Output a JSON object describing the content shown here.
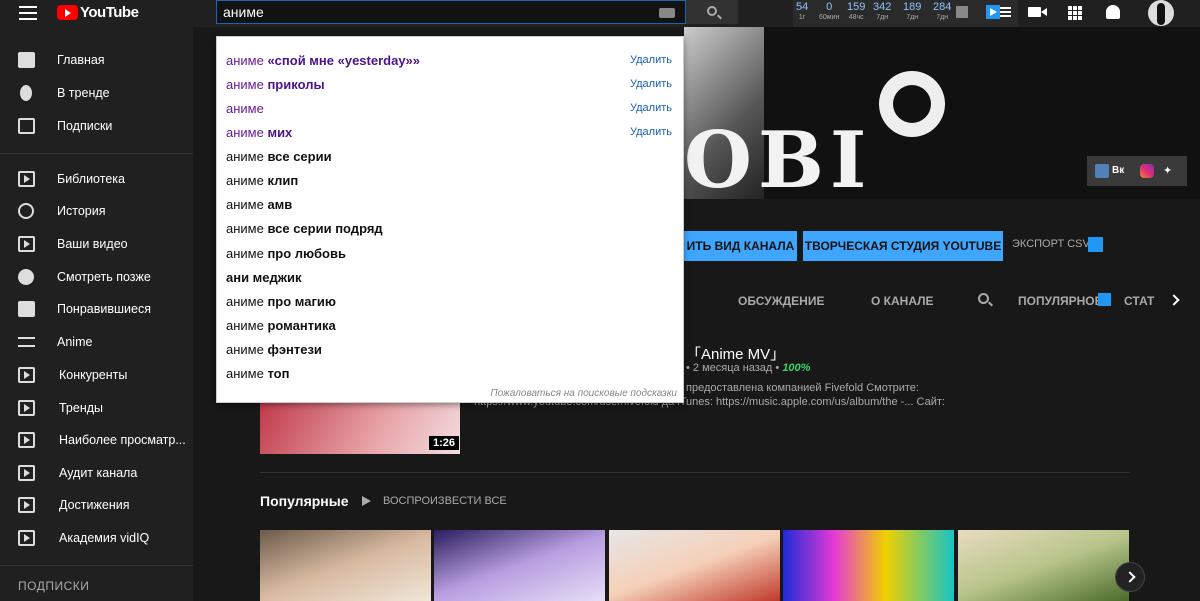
{
  "header": {
    "logo_text": "YouTube",
    "search_value": "аниме",
    "stats": [
      {
        "value": "54",
        "label": "1г"
      },
      {
        "value": "0",
        "label": "60мин"
      },
      {
        "value": "159",
        "label": "48чс"
      },
      {
        "value": "342",
        "label": "7дн"
      },
      {
        "value": "189",
        "label": "7дн"
      },
      {
        "value": "284",
        "label": "7дн"
      }
    ]
  },
  "sidebar": {
    "items": [
      {
        "label": "Главная",
        "icon": "home-icon"
      },
      {
        "label": "В тренде",
        "icon": "flame-icon"
      },
      {
        "label": "Подписки",
        "icon": "subscriptions-icon"
      },
      {
        "label": "Библиотека",
        "icon": "library-icon"
      },
      {
        "label": "История",
        "icon": "history-icon"
      },
      {
        "label": "Ваши видео",
        "icon": "your-videos-icon"
      },
      {
        "label": "Смотреть позже",
        "icon": "watch-later-icon"
      },
      {
        "label": "Понравившиеся",
        "icon": "thumbs-up-icon"
      },
      {
        "label": "Anime",
        "icon": "playlist-icon"
      },
      {
        "label": "Конкуренты",
        "icon": "vidiq-icon"
      },
      {
        "label": "Тренды",
        "icon": "vidiq-icon"
      },
      {
        "label": "Наиболее просматр...",
        "icon": "vidiq-icon"
      },
      {
        "label": "Аудит канала",
        "icon": "vidiq-icon"
      },
      {
        "label": "Достижения",
        "icon": "vidiq-icon"
      },
      {
        "label": "Академия vidIQ",
        "icon": "vidiq-icon"
      }
    ],
    "subscriptions_heading": "ПОДПИСКИ"
  },
  "suggestions": [
    {
      "prefix": "аниме ",
      "rest": "«спой мне «yesterday»»",
      "visited": true,
      "delete": "Удалить"
    },
    {
      "prefix": "аниме ",
      "rest": "приколы",
      "visited": true,
      "delete": "Удалить"
    },
    {
      "prefix": "аниме",
      "rest": "",
      "visited": true,
      "delete": "Удалить"
    },
    {
      "prefix": "аниме ",
      "rest": "мих",
      "visited": true,
      "delete": "Удалить"
    },
    {
      "prefix": "аниме ",
      "rest": "все серии",
      "visited": false
    },
    {
      "prefix": "аниме ",
      "rest": "клип",
      "visited": false
    },
    {
      "prefix": "аниме ",
      "rest": "амв",
      "visited": false
    },
    {
      "prefix": "аниме ",
      "rest": "все серии подряд",
      "visited": false
    },
    {
      "prefix": "аниме ",
      "rest": "про любовь",
      "visited": false
    },
    {
      "prefix": "",
      "rest": "ани меджик",
      "visited": false
    },
    {
      "prefix": "аниме ",
      "rest": "про магию",
      "visited": false
    },
    {
      "prefix": "аниме ",
      "rest": "романтика",
      "visited": false
    },
    {
      "prefix": "аниме ",
      "rest": "фэнтези",
      "visited": false
    },
    {
      "prefix": "аниме ",
      "rest": "топ",
      "visited": false
    }
  ],
  "report_link": "Пожаловаться на поисковые подсказки",
  "channel": {
    "banner_text": "OBI",
    "social_vk": "Вк",
    "customize_button": "ИТЬ ВИД КАНАЛА",
    "studio_button": "ТВОРЧЕСКАЯ СТУДИЯ YOUTUBE",
    "export_label": "ЭКСПОРТ CSV",
    "tabs": [
      "ОБСУЖДЕНИЕ",
      "О КАНАЛЕ",
      "ПОПУЛЯРНОЕ",
      "СТАТ"
    ]
  },
  "featured": {
    "title": "「Anime MV」",
    "meta": "• 2 месяца назад •",
    "score": "100%",
    "desc_line1": "предоставлена компанией Fivefold Смотрите:",
    "desc_line2": "https://www.youtube.com/user/fivefold да iTunes: https://music.apple.com/us/album/the -... Сайт:",
    "duration": "1:26"
  },
  "popular": {
    "title": "Популярные",
    "play_all": "ВОСПРОИЗВЕСТИ ВСЕ"
  },
  "colors": {
    "accent_blue": "#3ea6ff",
    "youtube_red": "#ff0000",
    "visited_suggestion": "#6a1b9a"
  }
}
